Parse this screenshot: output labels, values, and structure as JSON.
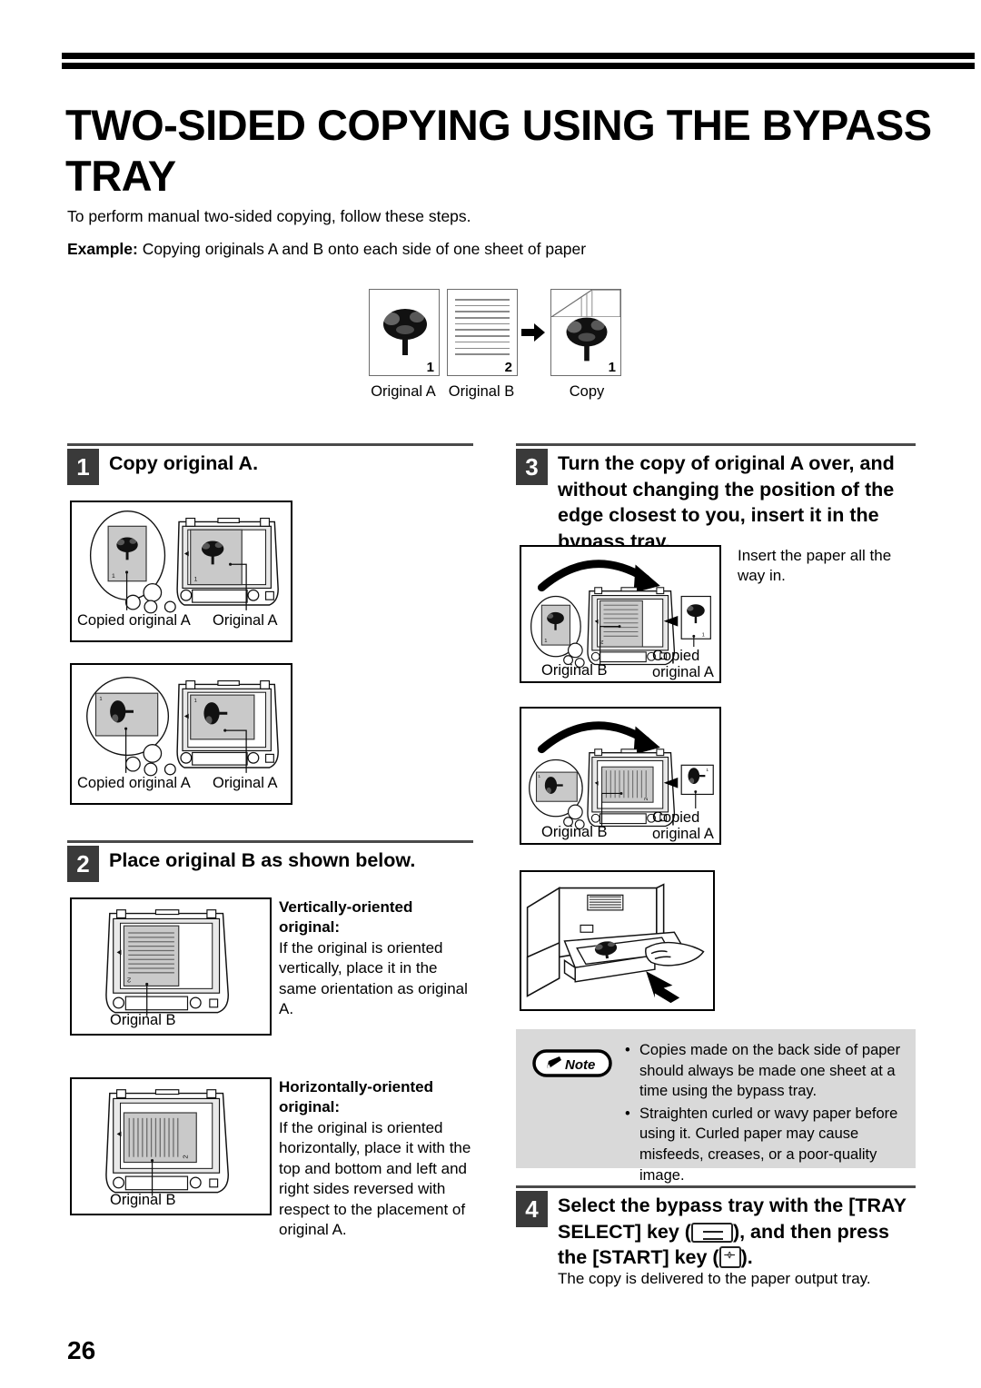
{
  "document": {
    "title": "TWO-SIDED COPYING USING THE BYPASS TRAY",
    "intro": "To perform manual two-sided copying, follow these steps.",
    "example_label": "Example:",
    "example_text": "Copying originals A and B onto each side of one sheet of paper",
    "page_number": "26"
  },
  "example_diagram": {
    "items": [
      {
        "label": "Original A",
        "corner_number": "1",
        "art": "tree-icon"
      },
      {
        "label": "Original B",
        "corner_number": "2",
        "art": "ruled-lines"
      },
      {
        "label": "Copy",
        "corner_number": "1",
        "art": "tree-icon-folded"
      }
    ],
    "arrow": "right-arrow-icon"
  },
  "steps": [
    {
      "number": "1",
      "heading": "Copy original A.",
      "figures": [
        {
          "name": "copier-top-view-vertical",
          "captions": [
            "Copied original A",
            "Original A"
          ]
        },
        {
          "name": "copier-top-view-horizontal",
          "captions": [
            "Copied original A",
            "Original A"
          ]
        }
      ]
    },
    {
      "number": "2",
      "heading": "Place original B as shown below.",
      "blocks": [
        {
          "figure_caption": "Original B",
          "lead": "Vertically-oriented original:",
          "body": "If the original is oriented vertically, place it in the same orientation as original A."
        },
        {
          "figure_caption": "Original B",
          "lead": "Horizontally-oriented original:",
          "body": "If the original is oriented horizontally, place it with the top and bottom and left and right sides reversed with respect to the placement of original A."
        }
      ]
    },
    {
      "number": "3",
      "heading": "Turn the copy of original A over, and without changing the position of the edge closest to you, insert it in the bypass tray.",
      "side_note": "Insert the paper all the way in.",
      "figures": [
        {
          "name": "flip-insert-vertical",
          "captions": [
            "Original B",
            "Copied original A"
          ]
        },
        {
          "name": "flip-insert-horizontal",
          "captions": [
            "Original B",
            "Copied original A"
          ]
        },
        {
          "name": "bypass-tray-hand-insert",
          "captions": []
        }
      ]
    },
    {
      "number": "4",
      "heading_part1": "Select the bypass tray with the [TRAY SELECT] key (",
      "heading_part2": "), and then press the [START] key (",
      "heading_part3": ").",
      "tray_key_icon": "tray-select-key-icon",
      "start_key_icon": "start-key-icon",
      "result": "The copy is delivered to the paper output tray."
    }
  ],
  "note": {
    "badge_label": "Note",
    "badge_icon": "pencil-icon",
    "items": [
      "Copies made on the back side of paper should always be made one sheet at a time using the bypass tray.",
      "Straighten curled or wavy paper before using it. Curled paper may cause misfeeds, creases, or a poor-quality image."
    ]
  },
  "colors": {
    "text": "#000000",
    "step_badge": "#3a3a3a",
    "note_background": "#d9d9d9",
    "paper_gray": "#c9c9c9",
    "rule": "#4a4a4a"
  }
}
